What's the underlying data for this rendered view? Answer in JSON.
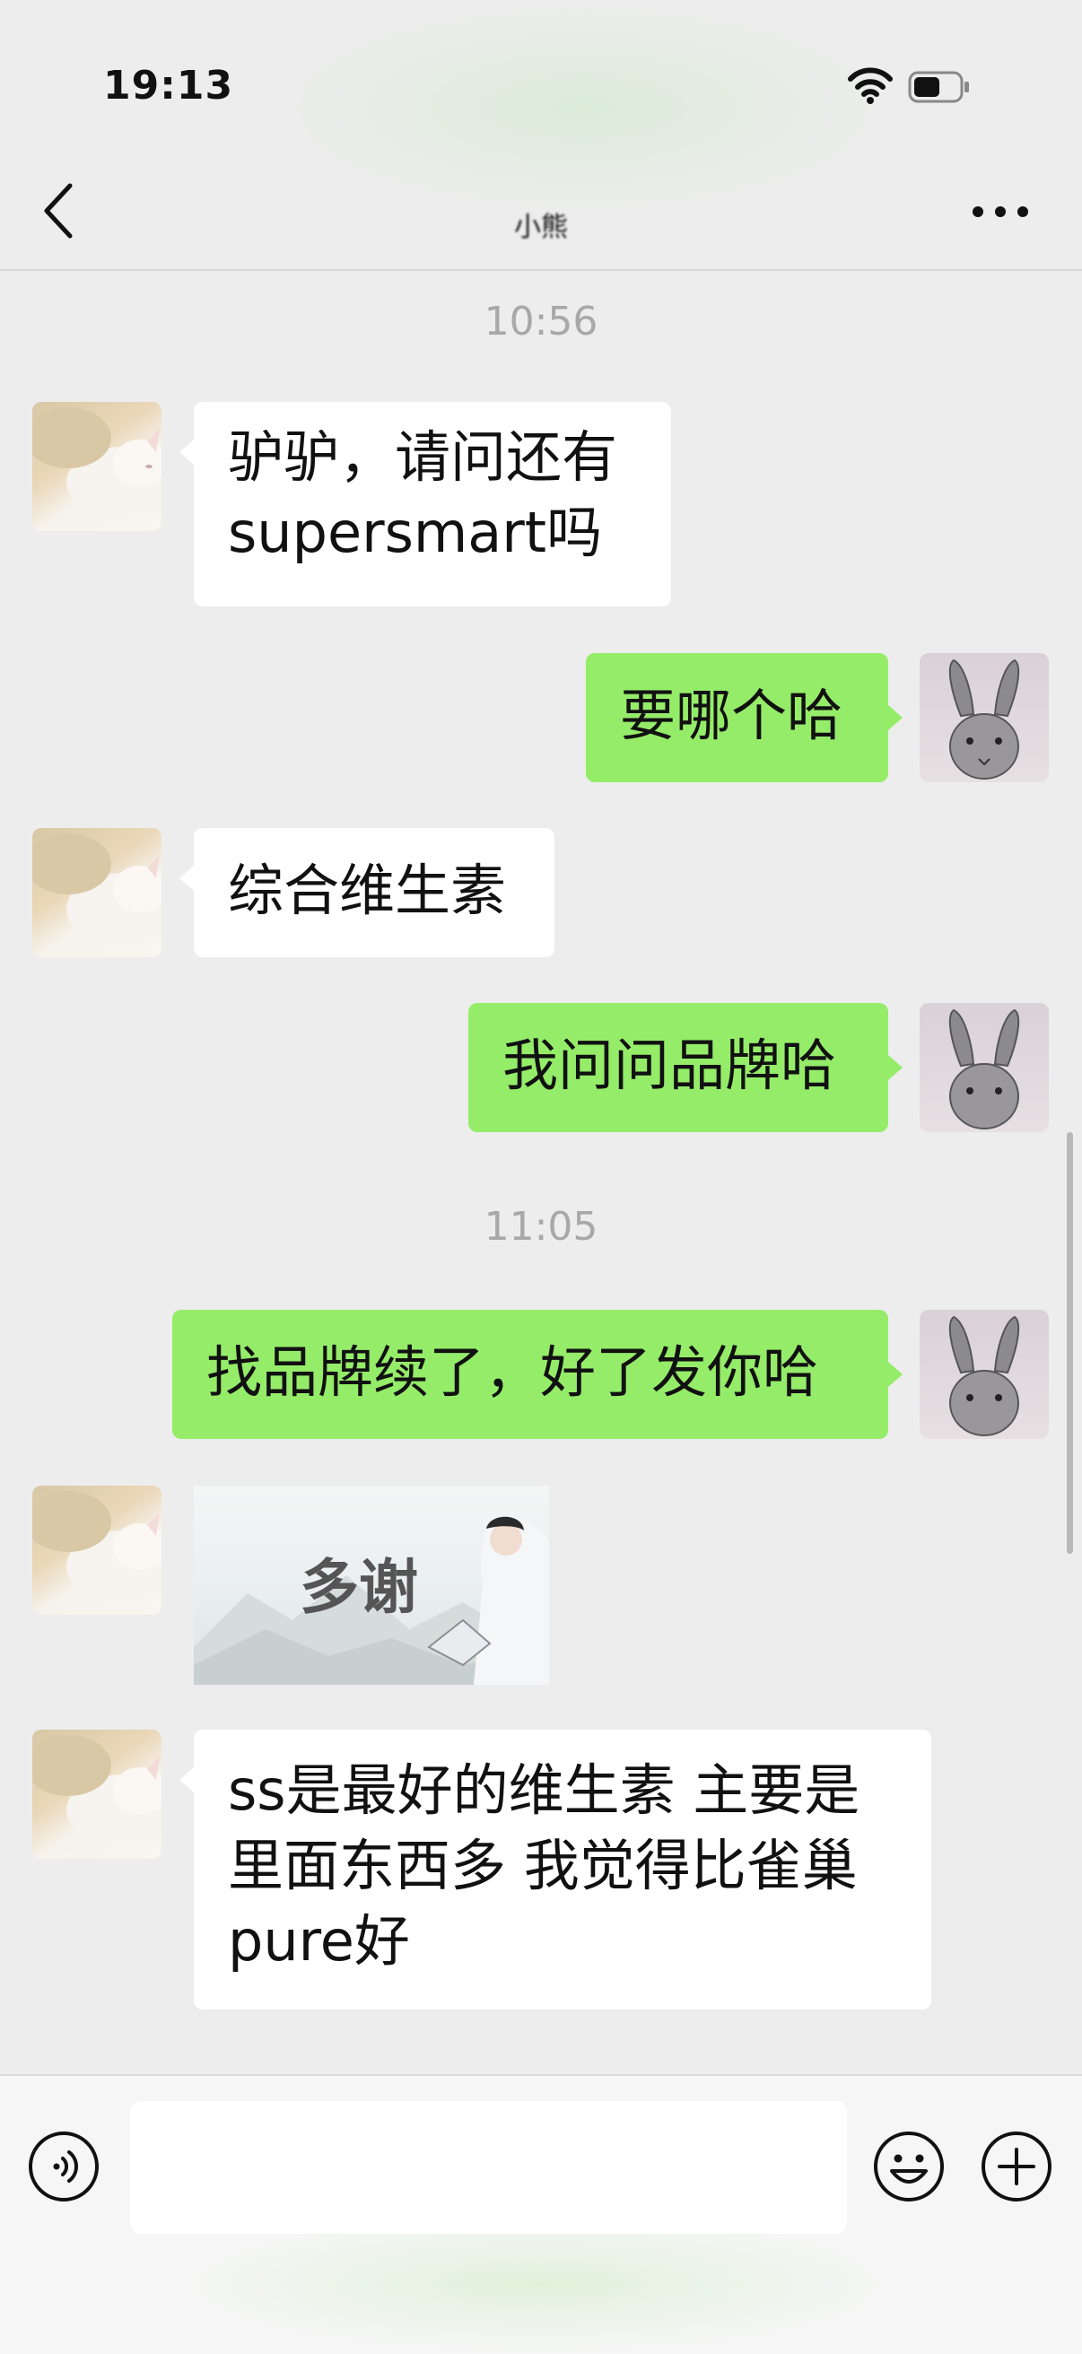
{
  "status_bar": {
    "time": "19:13"
  },
  "nav": {
    "title": "小熊"
  },
  "timestamps": [
    "10:56",
    "11:05"
  ],
  "messages": [
    {
      "side": "left",
      "text": "驴驴，请问还有supersmart吗"
    },
    {
      "side": "right",
      "text": "要哪个哈"
    },
    {
      "side": "left",
      "text": "综合维生素"
    },
    {
      "side": "right",
      "text": "我问问品牌哈"
    },
    {
      "side": "right",
      "text": "找品牌续了，好了发你哈"
    },
    {
      "side": "left",
      "type": "sticker",
      "text": "多谢"
    },
    {
      "side": "left",
      "text": "ss是最好的维生素 主要是里面东西多 我觉得比雀巢pure好"
    }
  ],
  "input": {
    "value": ""
  },
  "icons": {
    "back": "chevron-left-icon",
    "more": "more-dots-icon",
    "voice": "voice-icon",
    "emoji": "emoji-icon",
    "plus": "plus-icon"
  },
  "colors": {
    "outgoing_bubble": "#95ec69",
    "incoming_bubble": "#ffffff",
    "background": "#ededed"
  }
}
